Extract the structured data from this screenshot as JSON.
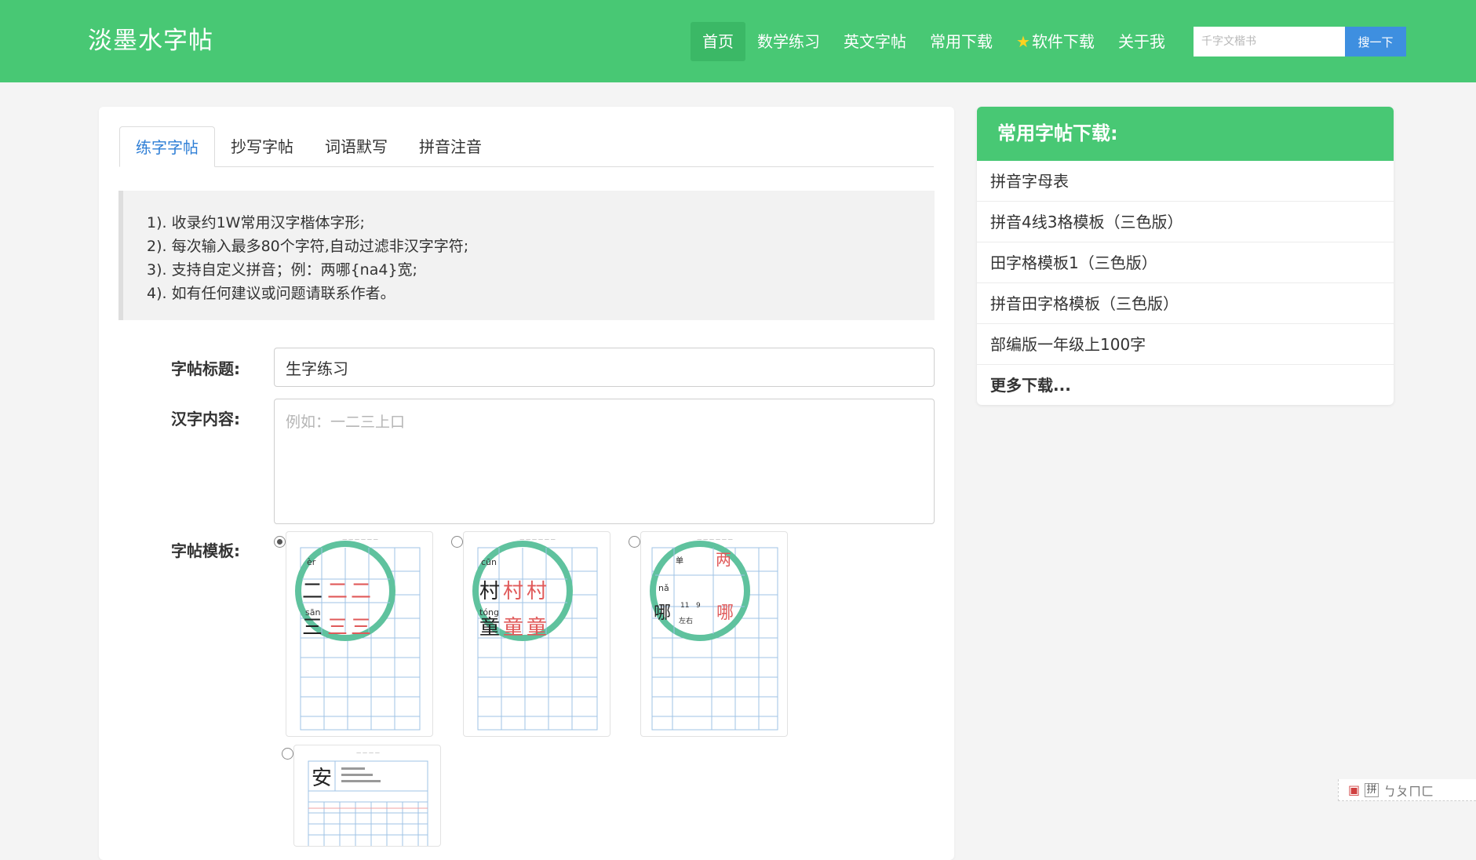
{
  "header": {
    "brand": "淡墨水字帖",
    "nav": [
      {
        "label": "首页",
        "active": true
      },
      {
        "label": "数学练习",
        "active": false
      },
      {
        "label": "英文字帖",
        "active": false
      },
      {
        "label": "常用下载",
        "active": false
      },
      {
        "label": "软件下载",
        "active": false,
        "icon": "star-icon"
      },
      {
        "label": "关于我",
        "active": false
      }
    ],
    "search": {
      "placeholder": "千字文楷书",
      "button_label": "搜一下"
    }
  },
  "tabs": [
    {
      "label": "练字字帖",
      "active": true
    },
    {
      "label": "抄写字帖",
      "active": false
    },
    {
      "label": "词语默写",
      "active": false
    },
    {
      "label": "拼音注音",
      "active": false
    }
  ],
  "notice": [
    "1). 收录约1W常用汉字楷体字形;",
    "2). 每次输入最多80个字符,自动过滤非汉字字符;",
    "3). 支持自定义拼音；例：两哪{na4}宽;",
    "4). 如有任何建议或问题请联系作者。"
  ],
  "form": {
    "title_label": "字帖标题:",
    "title_value": "生字练习",
    "content_label": "汉字内容:",
    "content_placeholder": "例如：一二三上口",
    "template_label": "字帖模板:"
  },
  "templates": [
    {
      "selected": true,
      "chars": [
        "二",
        "二",
        "二",
        "三",
        "三",
        "三"
      ],
      "pinyin": [
        "èr",
        "sān"
      ]
    },
    {
      "selected": false,
      "chars": [
        "村",
        "村",
        "村",
        "童",
        "童",
        "童"
      ],
      "pinyin": [
        "cūn",
        "tóng"
      ]
    },
    {
      "selected": false,
      "chars": [
        "单",
        "两",
        "哪",
        "哪"
      ],
      "pinyin": [
        "nǎ"
      ],
      "extra": [
        "11",
        "9",
        "左右"
      ]
    },
    {
      "selected": false,
      "chars": [
        "安"
      ]
    }
  ],
  "sidebar": {
    "title": "常用字帖下载:",
    "items": [
      "拼音字母表",
      "拼音4线3格模板（三色版）",
      "田字格模板1（三色版）",
      "拼音田字格模板（三色版）",
      "部编版一年级上100字"
    ],
    "more": "更多下载..."
  },
  "corner_toolbar": {
    "icons": [
      "pdf-icon",
      "pinyin-box-icon"
    ],
    "pinyin_box": "拼",
    "letters": "ㄅㄆㄇㄈ"
  },
  "colors": {
    "brand_green": "#48c874",
    "search_blue": "#3e8fe0",
    "circle_green": "#5fc29e",
    "practice_red": "#e05a5a"
  }
}
